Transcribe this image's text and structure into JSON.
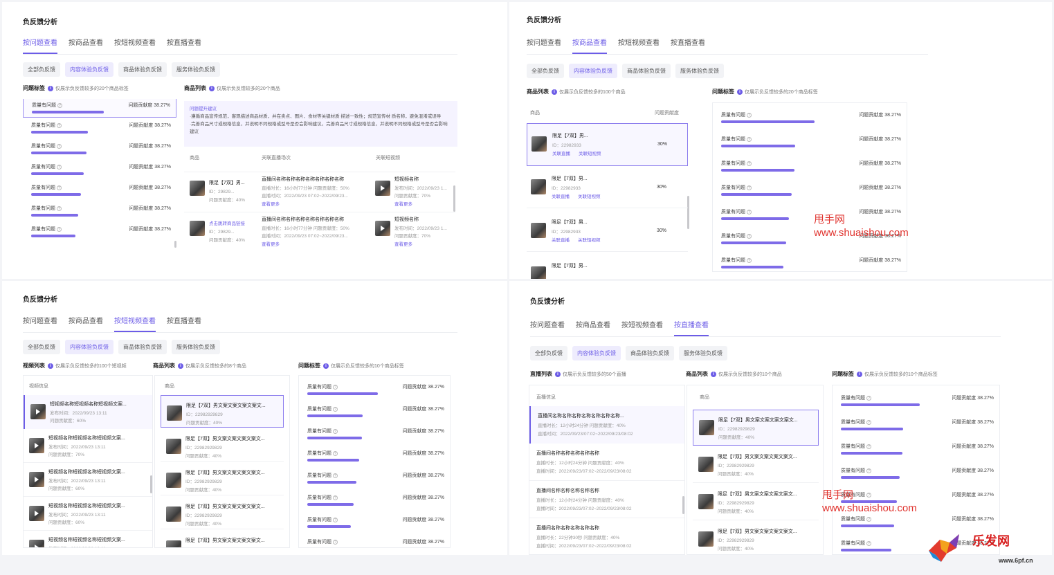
{
  "title": "负反馈分析",
  "tabs": [
    "按问题查看",
    "按商品查看",
    "按短视频查看",
    "按直播查看"
  ],
  "chips": [
    "全部负反馈",
    "内容体验负反馈",
    "商品体验负反馈",
    "服务体验负反馈"
  ],
  "issue": {
    "label": "质量有问题",
    "value": "问题贡献度 38.27%"
  },
  "issue_fill": [
    0.85,
    0.7,
    0.72,
    0.72,
    0.72,
    0.72,
    0.72,
    0.72
  ],
  "sections": {
    "issue_tags": "问题标签",
    "issue_tags_note20": "仅展示负反馈较多的20个商品标签",
    "issue_tags_note10": "仅展示负反馈较多的10个商品标签",
    "product_list": "商品列表",
    "product_note20": "仅展示负反馈较多的20个商品",
    "product_note100": "仅展示负反馈较多的100个商品",
    "product_note8": "仅展示负反馈较多的8个商品",
    "product_note10": "仅展示负反馈较多的10个商品",
    "video_list": "视频列表",
    "video_note": "仅展示负反馈较多的100个短视频",
    "live_list": "直播列表",
    "live_note": "仅展示负反馈较多的50个直播"
  },
  "tip": {
    "title": "问题提升建议",
    "line1": "·遵循商品宣传规范，客观描述商品材质，并在卖点、图片、食材等关键材质 描述一致性；规范宣传材 质名称，避免混淆或误导",
    "line2": "·完善商品尺寸或规格信息，并说明不同规格或型号是否会影响建议，完善商品尺寸或规格信息，并说明不同规格或型号是否会影响建议"
  },
  "cols": {
    "product": "商品",
    "related_live": "关联直播场次",
    "related_video": "关联短视频",
    "contrib": "问题贡献度",
    "video_info": "视频信息",
    "live_info": "直播信息"
  },
  "q1rows": [
    {
      "name": "限足【7双】男...",
      "id": "ID：29829...",
      "contrib": "问题贡献度：40%",
      "live_title": "直播间名称名称名称名称名称名称名称",
      "live_dur": "直播时长：16小时77分钟  问题贡献度：50%",
      "live_time": "直播时间：2022/09/23 07:02~2022/09/23...",
      "more": "查看更多",
      "vname": "短视频名称",
      "vtime": "发布时间：2022/09/23 1...",
      "vc": "问题贡献度：70%",
      "vmore": "查看更多"
    },
    {
      "name": "点击跳转商品链接",
      "id": "ID：29829...",
      "contrib": "问题贡献度：40%",
      "live_title": "直播间名称名称名称名称名称名称名称",
      "live_dur": "直播时长：16小时77分钟  问题贡献度：50%",
      "live_time": "直播时间：2022/09/23 07:02~2022/09/23...",
      "more": "查看更多",
      "vname": "短视频名称",
      "vtime": "发布时间：2022/09/23 1...",
      "vc": "问题贡献度：70%",
      "vmore": "查看更多"
    }
  ],
  "q2rows": [
    {
      "name": "限足【7双】男...",
      "id": "ID：22982933",
      "l1": "关联直播",
      "l2": "关联短视频",
      "pct": "30%"
    },
    {
      "name": "限足【7双】男...",
      "id": "ID：22982933",
      "l1": "关联直播",
      "l2": "关联短视频",
      "pct": "30%"
    },
    {
      "name": "限足【7双】男...",
      "id": "ID：22982933",
      "l1": "关联直播",
      "l2": "关联短视频",
      "pct": "30%"
    },
    {
      "name": "限足【7双】男...",
      "id": "",
      "l1": "",
      "l2": "",
      "pct": ""
    }
  ],
  "q3videos": [
    {
      "name": "短视频名称短视频名称短视频文案...",
      "time": "发布时间：2022/09/23 13:11",
      "c": "问题贡献度：60%"
    },
    {
      "name": "短视频名称短视频名称短视频文案...",
      "time": "发布时间：2022/09/23 13:11",
      "c": "问题贡献度：70%"
    },
    {
      "name": "短视频名称短视频名称短视频文案...",
      "time": "发布时间：2022/09/23 13:11",
      "c": "问题贡献度：60%"
    },
    {
      "name": "短视频名称短视频名称短视频文案...",
      "time": "发布时间：2022/09/23 13:11",
      "c": "问题贡献度：60%"
    },
    {
      "name": "短视频名称短视频名称短视频文案...",
      "time": "发布时间：2022/09/23 13:11",
      "c": "问题贡献度：60%"
    }
  ],
  "product_item": {
    "name": "限足【7双】男文案文案文案文案文...",
    "id": "ID：22982929829",
    "c": "问题贡献度：40%"
  },
  "q4lives": [
    {
      "name": "直播间名称名称名称名称名称名称名称...",
      "dur": "直播时长：12小时24分钟  问题贡献度：40%",
      "time": "直播时间：2022/09/23/07:02~2022/09/23/08:02"
    },
    {
      "name": "直播间名称名称名称名称名称",
      "dur": "直播时长：12小时24分钟  问题贡献度：40%",
      "time": "直播时间：2022/09/23/07:02~2022/09/23/08:02"
    },
    {
      "name": "直播间名称名称名称名称名称",
      "dur": "直播时长：12小时24分钟  问题贡献度：40%",
      "time": "直播时间：2022/09/23/07:02~2022/09/23/08:02"
    },
    {
      "name": "直播间名称名称名称名称名称",
      "dur": "直播时长：22分钟30秒  问题贡献度：40%",
      "time": "直播时间：2022/09/23/07:02~2022/09/23/08:02"
    }
  ],
  "watermark": {
    "name": "甩手网",
    "url": "www.shuaishou.com"
  },
  "logo": {
    "text": "乐发网",
    "url": "www.6pf.cn"
  },
  "colors": {
    "accent": "#6c5ce7",
    "bar": "#7e6be8",
    "watermark": "#e0342f"
  }
}
